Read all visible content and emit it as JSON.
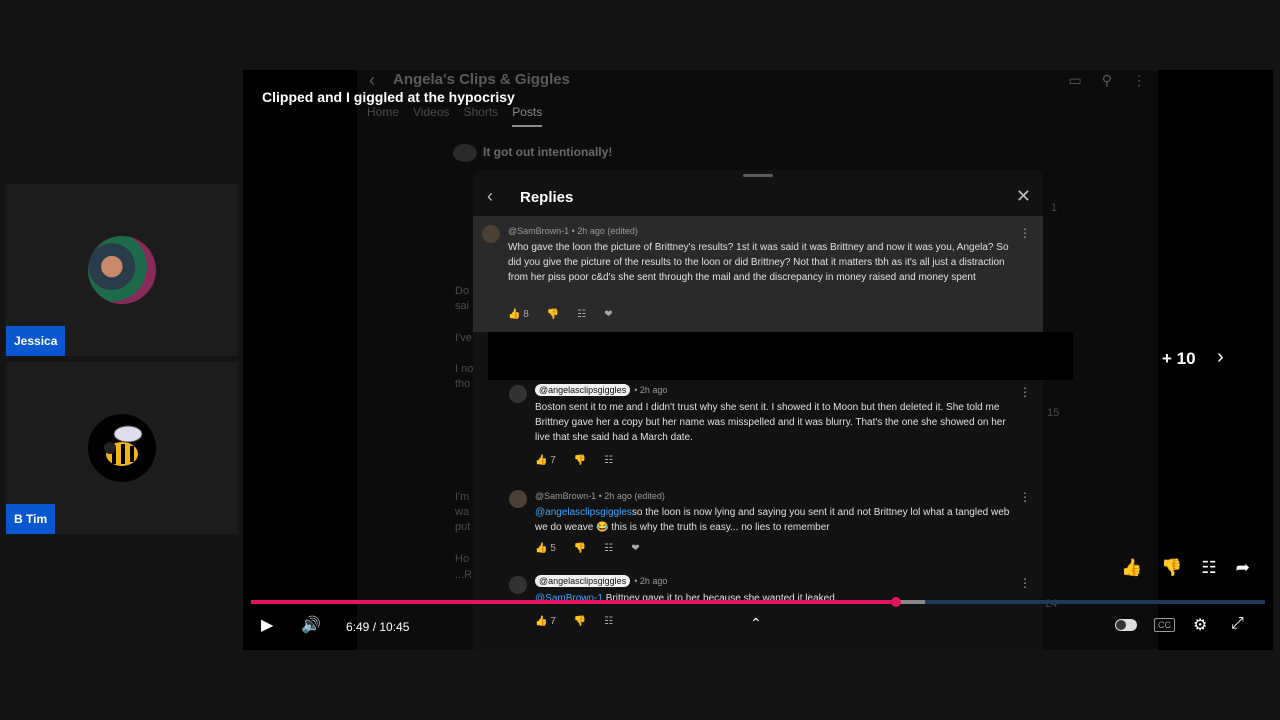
{
  "participants": [
    {
      "name": "Jessica"
    },
    {
      "name": "B Tim"
    }
  ],
  "player": {
    "video_title": "Clipped and I giggled at the hypocrisy",
    "skip_label": "+ 10",
    "time": "6:49 / 10:45",
    "progress": 0.636,
    "buffered": 0.665
  },
  "yt": {
    "channel_title": "Angela's Clips & Giggles",
    "tabs": [
      {
        "label": "Home"
      },
      {
        "label": "Videos"
      },
      {
        "label": "Shorts"
      },
      {
        "label": "Posts"
      }
    ],
    "post_text": "It got out intentionally!",
    "bg_count_1": "1",
    "bg_count_2": "15",
    "bg_count_3": "24",
    "bg_snippets": [
      "Do",
      "sai",
      "I've",
      "I no",
      "tho",
      "I'm",
      "wa",
      "put",
      "Ho",
      "...R"
    ]
  },
  "replies_sheet": {
    "title": "Replies",
    "parent": {
      "author_meta": "@SamBrown-1 • 2h ago (edited)",
      "text": "Who gave the loon the picture of Brittney's results? 1st it was said it was Brittney and now it was you, Angela? So did you give the picture of the results to the loon or did Brittney? Not that it matters tbh as it's all just a distraction from her piss poor c&d's she sent through the mail and the discrepancy in money raised and money spent",
      "likes": "8"
    },
    "replies": [
      {
        "author": "@angelasclipsgiggles",
        "time": "• 2h ago",
        "mention": "",
        "text": "Boston sent it to me and I didn't trust why she sent it. I showed it to Moon but then deleted it. She told me Brittney gave her a copy but her name was misspelled and it was blurry. That's the one she showed on her live that she said had a March date.",
        "likes": "7"
      },
      {
        "author": "@SamBrown-1 • 2h ago (edited)",
        "time": "",
        "mention": "@angelasclipsgiggles",
        "text": "so the loon is now lying and saying you sent it and not Brittney lol what a tangled web we do weave 😂 this is why the truth is easy... no lies to remember",
        "likes": "5"
      },
      {
        "author": "@angelasclipsgiggles",
        "time": "• 2h ago",
        "mention": "@SamBrown-1",
        "text": " Brittney gave it to her because she wanted it leaked.",
        "likes": "7"
      }
    ]
  },
  "colors": {
    "progress": "#e5135f",
    "name_tag": "#0b57d0",
    "mention": "#3ea6ff"
  }
}
